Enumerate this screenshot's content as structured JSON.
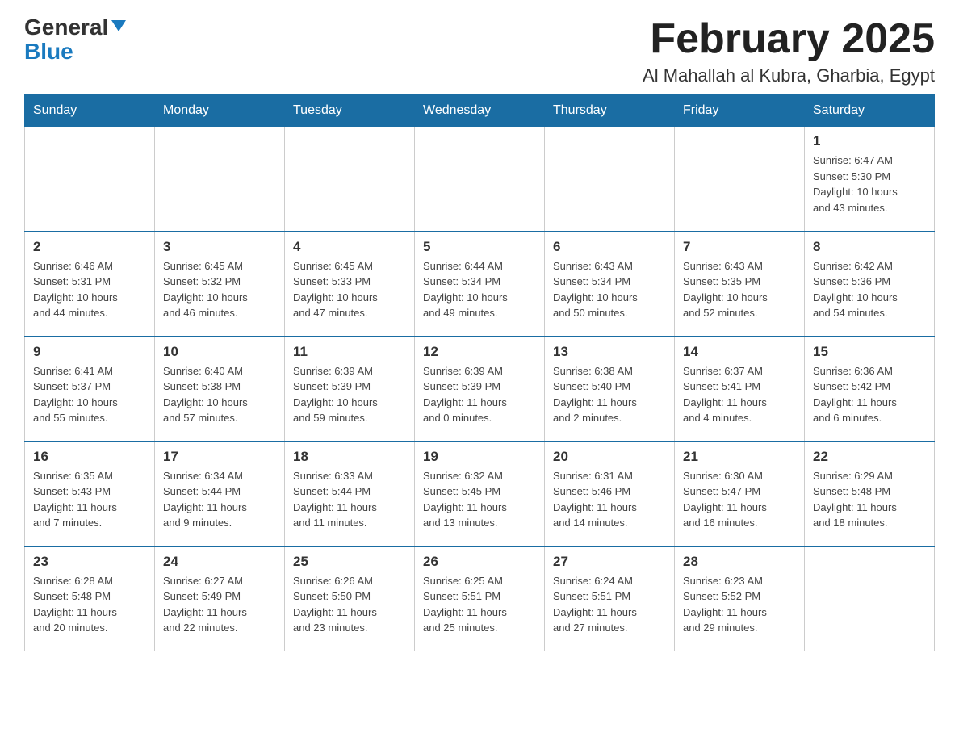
{
  "header": {
    "logo_general": "General",
    "logo_blue": "Blue",
    "title": "February 2025",
    "subtitle": "Al Mahallah al Kubra, Gharbia, Egypt"
  },
  "weekdays": [
    "Sunday",
    "Monday",
    "Tuesday",
    "Wednesday",
    "Thursday",
    "Friday",
    "Saturday"
  ],
  "weeks": [
    [
      {
        "day": "",
        "info": ""
      },
      {
        "day": "",
        "info": ""
      },
      {
        "day": "",
        "info": ""
      },
      {
        "day": "",
        "info": ""
      },
      {
        "day": "",
        "info": ""
      },
      {
        "day": "",
        "info": ""
      },
      {
        "day": "1",
        "info": "Sunrise: 6:47 AM\nSunset: 5:30 PM\nDaylight: 10 hours\nand 43 minutes."
      }
    ],
    [
      {
        "day": "2",
        "info": "Sunrise: 6:46 AM\nSunset: 5:31 PM\nDaylight: 10 hours\nand 44 minutes."
      },
      {
        "day": "3",
        "info": "Sunrise: 6:45 AM\nSunset: 5:32 PM\nDaylight: 10 hours\nand 46 minutes."
      },
      {
        "day": "4",
        "info": "Sunrise: 6:45 AM\nSunset: 5:33 PM\nDaylight: 10 hours\nand 47 minutes."
      },
      {
        "day": "5",
        "info": "Sunrise: 6:44 AM\nSunset: 5:34 PM\nDaylight: 10 hours\nand 49 minutes."
      },
      {
        "day": "6",
        "info": "Sunrise: 6:43 AM\nSunset: 5:34 PM\nDaylight: 10 hours\nand 50 minutes."
      },
      {
        "day": "7",
        "info": "Sunrise: 6:43 AM\nSunset: 5:35 PM\nDaylight: 10 hours\nand 52 minutes."
      },
      {
        "day": "8",
        "info": "Sunrise: 6:42 AM\nSunset: 5:36 PM\nDaylight: 10 hours\nand 54 minutes."
      }
    ],
    [
      {
        "day": "9",
        "info": "Sunrise: 6:41 AM\nSunset: 5:37 PM\nDaylight: 10 hours\nand 55 minutes."
      },
      {
        "day": "10",
        "info": "Sunrise: 6:40 AM\nSunset: 5:38 PM\nDaylight: 10 hours\nand 57 minutes."
      },
      {
        "day": "11",
        "info": "Sunrise: 6:39 AM\nSunset: 5:39 PM\nDaylight: 10 hours\nand 59 minutes."
      },
      {
        "day": "12",
        "info": "Sunrise: 6:39 AM\nSunset: 5:39 PM\nDaylight: 11 hours\nand 0 minutes."
      },
      {
        "day": "13",
        "info": "Sunrise: 6:38 AM\nSunset: 5:40 PM\nDaylight: 11 hours\nand 2 minutes."
      },
      {
        "day": "14",
        "info": "Sunrise: 6:37 AM\nSunset: 5:41 PM\nDaylight: 11 hours\nand 4 minutes."
      },
      {
        "day": "15",
        "info": "Sunrise: 6:36 AM\nSunset: 5:42 PM\nDaylight: 11 hours\nand 6 minutes."
      }
    ],
    [
      {
        "day": "16",
        "info": "Sunrise: 6:35 AM\nSunset: 5:43 PM\nDaylight: 11 hours\nand 7 minutes."
      },
      {
        "day": "17",
        "info": "Sunrise: 6:34 AM\nSunset: 5:44 PM\nDaylight: 11 hours\nand 9 minutes."
      },
      {
        "day": "18",
        "info": "Sunrise: 6:33 AM\nSunset: 5:44 PM\nDaylight: 11 hours\nand 11 minutes."
      },
      {
        "day": "19",
        "info": "Sunrise: 6:32 AM\nSunset: 5:45 PM\nDaylight: 11 hours\nand 13 minutes."
      },
      {
        "day": "20",
        "info": "Sunrise: 6:31 AM\nSunset: 5:46 PM\nDaylight: 11 hours\nand 14 minutes."
      },
      {
        "day": "21",
        "info": "Sunrise: 6:30 AM\nSunset: 5:47 PM\nDaylight: 11 hours\nand 16 minutes."
      },
      {
        "day": "22",
        "info": "Sunrise: 6:29 AM\nSunset: 5:48 PM\nDaylight: 11 hours\nand 18 minutes."
      }
    ],
    [
      {
        "day": "23",
        "info": "Sunrise: 6:28 AM\nSunset: 5:48 PM\nDaylight: 11 hours\nand 20 minutes."
      },
      {
        "day": "24",
        "info": "Sunrise: 6:27 AM\nSunset: 5:49 PM\nDaylight: 11 hours\nand 22 minutes."
      },
      {
        "day": "25",
        "info": "Sunrise: 6:26 AM\nSunset: 5:50 PM\nDaylight: 11 hours\nand 23 minutes."
      },
      {
        "day": "26",
        "info": "Sunrise: 6:25 AM\nSunset: 5:51 PM\nDaylight: 11 hours\nand 25 minutes."
      },
      {
        "day": "27",
        "info": "Sunrise: 6:24 AM\nSunset: 5:51 PM\nDaylight: 11 hours\nand 27 minutes."
      },
      {
        "day": "28",
        "info": "Sunrise: 6:23 AM\nSunset: 5:52 PM\nDaylight: 11 hours\nand 29 minutes."
      },
      {
        "day": "",
        "info": ""
      }
    ]
  ]
}
